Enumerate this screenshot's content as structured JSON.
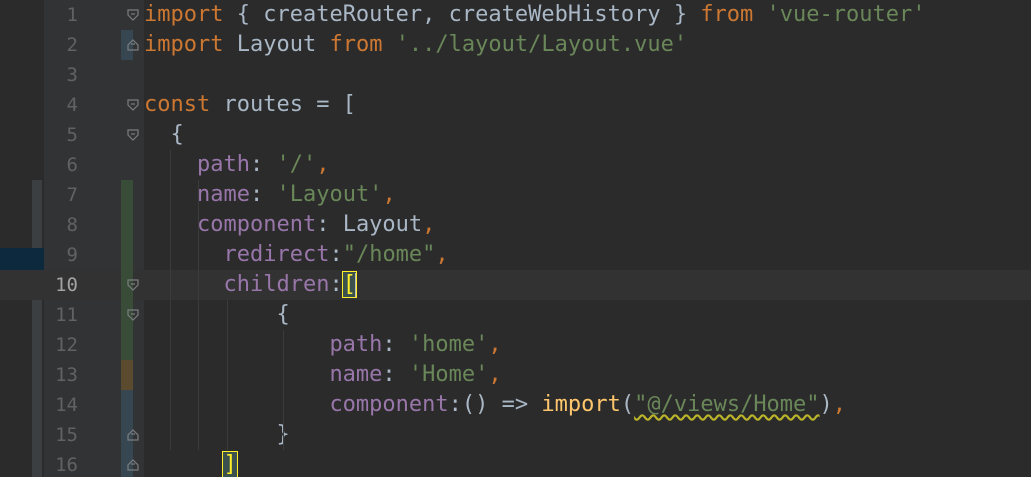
{
  "editor": {
    "language": "javascript",
    "current_line": 10,
    "colors": {
      "background": "#2b2b2b",
      "gutter": "#313335",
      "keyword": "#cc7832",
      "string": "#6a8759",
      "property": "#9876aa",
      "function": "#ffc66d",
      "default": "#a9b7c6",
      "line_number": "#606366",
      "change_added": "#384c38",
      "change_modified": "#374752",
      "change_other": "#5c4a2e"
    },
    "lines": [
      {
        "num": "1",
        "change": null,
        "fold": "open",
        "tokens": [
          [
            "kw",
            "import"
          ],
          [
            "t",
            " { createRouter, createWebHistory } "
          ],
          [
            "kw",
            "from"
          ],
          [
            "t",
            " "
          ],
          [
            "str",
            "'vue-router'"
          ]
        ]
      },
      {
        "num": "2",
        "change": "modified",
        "fold": "end",
        "tokens": [
          [
            "kw",
            "import"
          ],
          [
            "t",
            " Layout "
          ],
          [
            "kw",
            "from"
          ],
          [
            "t",
            " "
          ],
          [
            "str",
            "'../layout/Layout.vue'"
          ]
        ]
      },
      {
        "num": "3",
        "change": null,
        "fold": null,
        "tokens": []
      },
      {
        "num": "4",
        "change": null,
        "fold": "open",
        "tokens": [
          [
            "kw",
            "const"
          ],
          [
            "t",
            " routes = ["
          ]
        ]
      },
      {
        "num": "5",
        "change": null,
        "fold": "open",
        "tokens": [
          [
            "t",
            "  {"
          ]
        ]
      },
      {
        "num": "6",
        "change": null,
        "fold": null,
        "tokens": [
          [
            "t",
            "    "
          ],
          [
            "prop",
            "path"
          ],
          [
            "t",
            ": "
          ],
          [
            "str",
            "'/'"
          ],
          [
            "kw",
            ","
          ]
        ]
      },
      {
        "num": "7",
        "change": "added",
        "fold": null,
        "tokens": [
          [
            "t",
            "    "
          ],
          [
            "prop",
            "name"
          ],
          [
            "t",
            ": "
          ],
          [
            "str",
            "'Layout'"
          ],
          [
            "kw",
            ","
          ]
        ]
      },
      {
        "num": "8",
        "change": "added",
        "fold": null,
        "tokens": [
          [
            "t",
            "    "
          ],
          [
            "prop",
            "component"
          ],
          [
            "t",
            ": Layout"
          ],
          [
            "kw",
            ","
          ]
        ]
      },
      {
        "num": "9",
        "change": "added",
        "fold": null,
        "tokens": [
          [
            "t",
            "      "
          ],
          [
            "prop",
            "redirect"
          ],
          [
            "t",
            ":"
          ],
          [
            "str",
            "\"/home\""
          ],
          [
            "kw",
            ","
          ]
        ]
      },
      {
        "num": "10",
        "change": "added",
        "fold": "open",
        "tokens": [
          [
            "t",
            "      "
          ],
          [
            "prop",
            "children"
          ],
          [
            "t",
            ":"
          ],
          [
            "bh",
            "["
          ],
          [
            "caret",
            ""
          ]
        ]
      },
      {
        "num": "11",
        "change": "added",
        "fold": "open",
        "tokens": [
          [
            "t",
            "          {"
          ]
        ]
      },
      {
        "num": "12",
        "change": "added",
        "fold": null,
        "tokens": [
          [
            "t",
            "              "
          ],
          [
            "prop",
            "path"
          ],
          [
            "t",
            ": "
          ],
          [
            "str",
            "'home'"
          ],
          [
            "kw",
            ","
          ]
        ]
      },
      {
        "num": "13",
        "change": "other",
        "fold": null,
        "tokens": [
          [
            "t",
            "              "
          ],
          [
            "prop",
            "name"
          ],
          [
            "t",
            ": "
          ],
          [
            "str",
            "'Home'"
          ],
          [
            "kw",
            ","
          ]
        ]
      },
      {
        "num": "14",
        "change": "modified",
        "fold": null,
        "tokens": [
          [
            "t",
            "              "
          ],
          [
            "prop",
            "component"
          ],
          [
            "t",
            ":() => "
          ],
          [
            "fn",
            "import"
          ],
          [
            "t",
            "("
          ],
          [
            "sq",
            "\"@/views/Home\""
          ],
          [
            "t",
            ")"
          ],
          [
            "kw",
            ","
          ]
        ]
      },
      {
        "num": "15",
        "change": "modified",
        "fold": "end",
        "tokens": [
          [
            "t",
            "          }"
          ]
        ]
      },
      {
        "num": "16",
        "change": "modified",
        "fold": "end",
        "tokens": [
          [
            "t",
            "      "
          ],
          [
            "bh",
            "]"
          ]
        ]
      }
    ]
  }
}
